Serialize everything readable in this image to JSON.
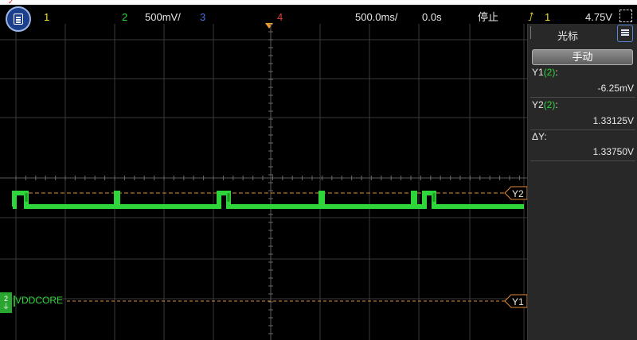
{
  "top_strip": {
    "text": ""
  },
  "status": {
    "ch1": "1",
    "ch2": "2",
    "ch2_scale": "500mV/",
    "ch3": "3",
    "ch4": "4",
    "timebase": "500.0ms/",
    "delay": "0.0s",
    "run_state": "停止",
    "trig_channel": "1",
    "trig_level": "4.75V"
  },
  "cursor_panel": {
    "title": "光标",
    "mode_button": "手动",
    "y1": {
      "label": "Y1",
      "source": "(2)",
      "suffix": ":",
      "value": "-6.25mV"
    },
    "y2": {
      "label": "Y2",
      "source": "(2)",
      "suffix": ":",
      "value": "1.33125V"
    },
    "delta_y": {
      "label": "ΔY:",
      "value": "1.33750V"
    }
  },
  "display": {
    "y2_marker": "Y2",
    "y1_marker": "Y1",
    "channel_label": "VDDCORE",
    "ground_marker": "2"
  },
  "colors": {
    "ch1": "#f2e530",
    "ch2": "#2fd63b",
    "ch3": "#4a6fe0",
    "ch4": "#e03c3c",
    "cursor": "#f29c2e",
    "grid": "#3a3a3a"
  },
  "icons": [
    "menu-icon",
    "trigger-edge-icon",
    "panel-menu-icon",
    "trigger-position-icon"
  ]
}
